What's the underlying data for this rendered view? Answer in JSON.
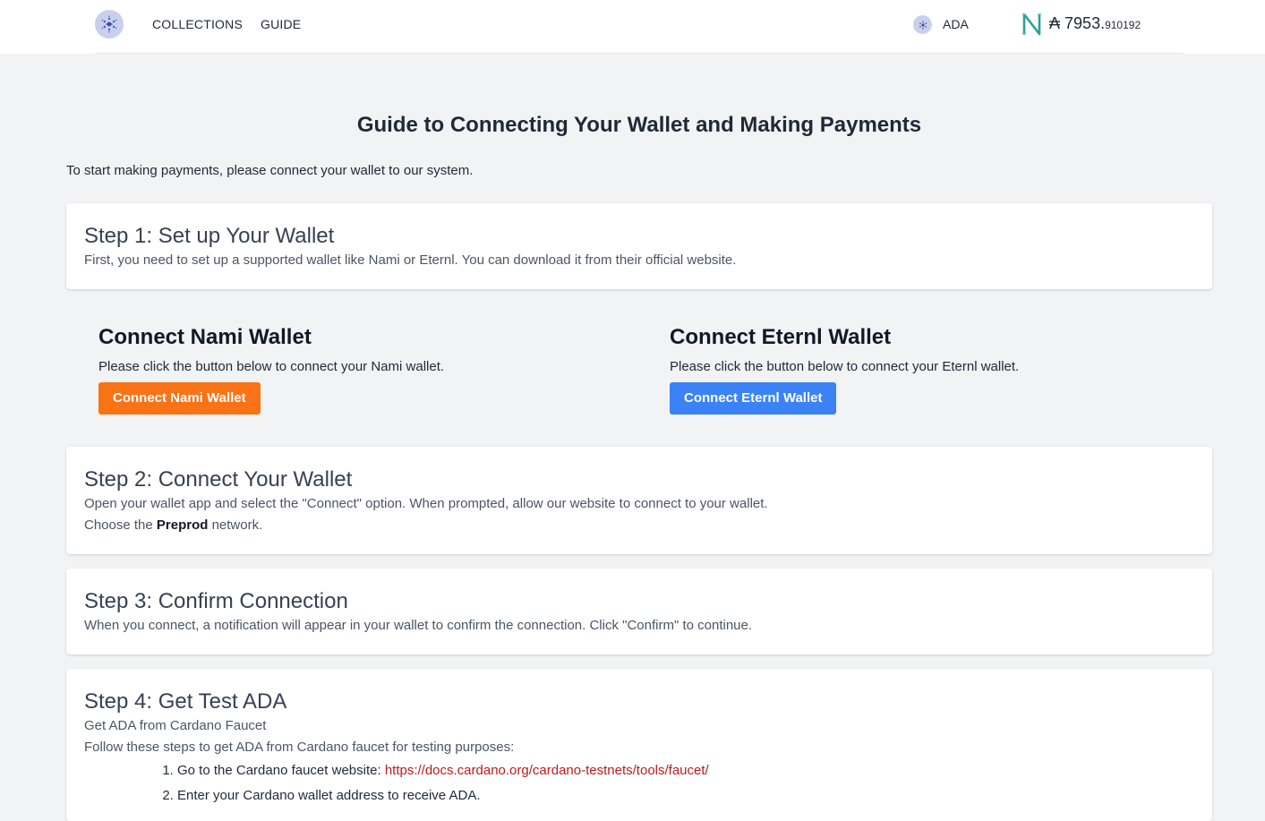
{
  "header": {
    "nav": [
      "COLLECTIONS",
      "GUIDE"
    ],
    "currency_label": "ADA",
    "balance_symbol": "₳",
    "balance_int": "7953.",
    "balance_frac": "910192"
  },
  "page": {
    "title": "Guide to Connecting Your Wallet and Making Payments",
    "intro": "To start making payments, please connect your wallet to our system."
  },
  "step1": {
    "title": "Step 1: Set up Your Wallet",
    "text": "First, you need to set up a supported wallet like Nami or Eternl. You can download it from their official website."
  },
  "nami": {
    "title": "Connect Nami Wallet",
    "text": "Please click the button below to connect your Nami wallet.",
    "button": "Connect Nami Wallet",
    "color": "#f97316"
  },
  "eternl": {
    "title": "Connect Eternl Wallet",
    "text": "Please click the button below to connect your Eternl wallet.",
    "button": "Connect Eternl Wallet",
    "color": "#3b82f6"
  },
  "step2": {
    "title": "Step 2: Connect Your Wallet",
    "text": "Open your wallet app and select the \"Connect\" option. When prompted, allow our website to connect to your wallet.",
    "network_pre": "Choose the ",
    "network": "Preprod",
    "network_post": " network."
  },
  "step3": {
    "title": "Step 3: Confirm Connection",
    "text": "When you connect, a notification will appear in your wallet to confirm the connection. Click \"Confirm\" to continue."
  },
  "step4": {
    "title": "Step 4: Get Test ADA",
    "subtitle": "Get ADA from Cardano Faucet",
    "text": "Follow these steps to get ADA from Cardano faucet for testing purposes:",
    "items": [
      {
        "text": "Go to the Cardano faucet website: ",
        "link": "https://docs.cardano.org/cardano-testnets/tools/faucet/"
      },
      {
        "text": "Enter your Cardano wallet address to receive ADA."
      }
    ]
  }
}
